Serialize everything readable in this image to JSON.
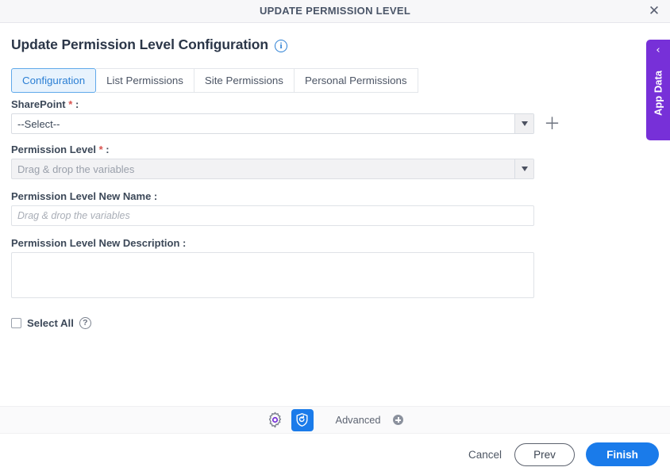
{
  "window": {
    "title": "UPDATE PERMISSION LEVEL",
    "close_icon": "close-icon",
    "close_glyph": "✕"
  },
  "page": {
    "heading": "Update Permission Level Configuration",
    "info_icon": "info-icon",
    "info_glyph": "i"
  },
  "tabs": [
    {
      "label": "Configuration",
      "active": true
    },
    {
      "label": "List Permissions",
      "active": false
    },
    {
      "label": "Site Permissions",
      "active": false
    },
    {
      "label": "Personal Permissions",
      "active": false
    }
  ],
  "form": {
    "sharepoint": {
      "label": "SharePoint",
      "required_marker": "*",
      "colon": ":",
      "value": "--Select--",
      "dropdown_icon": "chevron-down-icon",
      "add_icon": "plus-icon",
      "add_glyph": "＋"
    },
    "permission_level": {
      "label": "Permission Level",
      "required_marker": "*",
      "colon": ":",
      "placeholder": "Drag & drop the variables",
      "value": "Drag & drop the variables",
      "disabled": true,
      "dropdown_icon": "chevron-down-icon"
    },
    "permission_level_new_name": {
      "label": "Permission Level New Name :",
      "placeholder": "Drag & drop the variables",
      "value": ""
    },
    "permission_level_new_description": {
      "label": "Permission Level New Description :",
      "placeholder": "",
      "value": ""
    },
    "select_all": {
      "label": "Select All",
      "checked": false,
      "help_icon": "help-icon",
      "help_glyph": "?"
    }
  },
  "app_data_tab": {
    "label": "App Data",
    "chevron_icon": "chevron-left-icon",
    "chevron_glyph": "‹",
    "color": "#7730d8"
  },
  "toolbar": {
    "settings_icon": "gear-icon",
    "validate_icon": "shield-refresh-icon",
    "advanced_label": "Advanced",
    "advanced_add_icon": "plus-circle-icon",
    "accent_color": "#1a7bea",
    "gear_accent_color": "#7730d8"
  },
  "footer": {
    "cancel_label": "Cancel",
    "prev_label": "Prev",
    "finish_label": "Finish"
  }
}
